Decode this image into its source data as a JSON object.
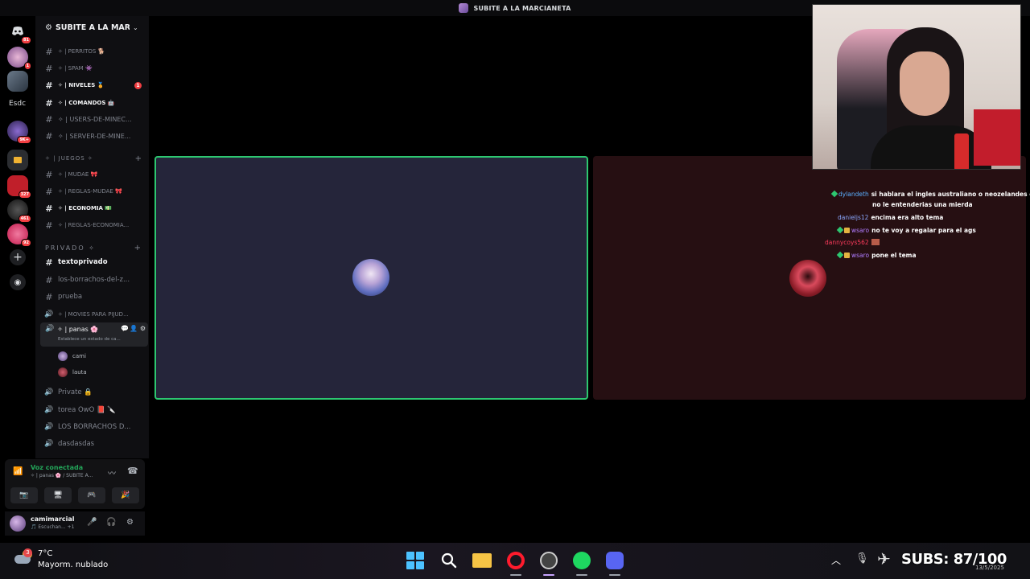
{
  "window": {
    "title": "SUBITE A LA MARCIANETA"
  },
  "rail": {
    "items": [
      {
        "icon": "discord-home-icon",
        "badge": "81"
      },
      {
        "icon": "server-avatar-icon",
        "badge": "1"
      },
      {
        "icon": "server-avatar-icon",
        "badge": ""
      },
      {
        "text": "Esdc"
      },
      {
        "icon": "server-avatar-icon",
        "badge": "9K+"
      },
      {
        "icon": "folder-icon",
        "badge": ""
      },
      {
        "icon": "server-avatar-icon",
        "badge": "327"
      },
      {
        "icon": "server-avatar-icon",
        "badge": "461"
      },
      {
        "icon": "server-avatar-icon",
        "badge": "92"
      }
    ]
  },
  "server": {
    "name": "SUBITE A LA MAR..."
  },
  "channels": [
    {
      "label": "✧ | PERRITOS 🐕",
      "type": "text"
    },
    {
      "label": "✧ | SPAM 👾",
      "type": "text"
    },
    {
      "label": "✧ | NIVELES 🏅",
      "type": "text",
      "unread": true,
      "mention": "1"
    },
    {
      "label": "✧ | COMANDOS 🤖",
      "type": "text",
      "unread": true
    },
    {
      "label": "✧ | USERS-DE-MINEC...",
      "type": "text"
    },
    {
      "label": "✧ | SERVER-DE-MINE...",
      "type": "text"
    },
    {
      "label": "✧ | MUDAE 🎀",
      "type": "text"
    },
    {
      "label": "✧ | REGLAS-MUDAE 🎀",
      "type": "text"
    },
    {
      "label": "✧ | ECONOMIA 💵",
      "type": "text",
      "unread": true
    },
    {
      "label": "✧ | REGLAS-ECONOMIA...",
      "type": "text"
    },
    {
      "label": "textoprivado",
      "type": "text",
      "unread": true
    },
    {
      "label": "los-borrachos-del-z...",
      "type": "text"
    },
    {
      "label": "prueba",
      "type": "text"
    },
    {
      "label": "✧ | MOVIES PARA PIJUD...",
      "type": "voice"
    },
    {
      "label": "✧ | panas 🌸",
      "type": "voice",
      "active": true,
      "status": "Establece un estado de ca..."
    },
    {
      "label": "Private 🔒",
      "type": "voice"
    },
    {
      "label": "torea OwO 📕 🔪",
      "type": "voice"
    },
    {
      "label": "LOS BORRACHOS D...",
      "type": "voice"
    },
    {
      "label": "dasdasdas",
      "type": "voice"
    }
  ],
  "categories": {
    "juegos": "✧ | JUEGOS ✧",
    "privado": "PRIVADO ✧"
  },
  "voice_users": [
    "cami",
    "lauta"
  ],
  "voice_panel": {
    "status": "Voz conectada",
    "channel": "✧ | panas 🌸 / SUBITE A..."
  },
  "user_panel": {
    "name": "camimarcial",
    "status": "🎵 Escuchan... +1"
  },
  "chat": [
    {
      "user": "dylandeth",
      "color": "#5bb0ff",
      "text": "si hablara el ingles australiano o neozelandes ese",
      "cont": "no le entenderias una mierda",
      "badge": "diamond"
    },
    {
      "user": "danieljs12",
      "color": "#8aa8ff",
      "text": "encima era alto tema",
      "badge": ""
    },
    {
      "user": "wsaro",
      "color": "#b07cff",
      "text": "no te voy a regalar       para el ags",
      "badge": "both"
    },
    {
      "user": "dannycoys562",
      "color": "#ff3b5c",
      "text": "",
      "badge": "emote"
    },
    {
      "user": "wsaro",
      "color": "#b07cff",
      "text": "pone el tema",
      "badge": "both"
    }
  ],
  "taskbar": {
    "weather_temp": "7°C",
    "weather_desc": "Mayorm. nublado",
    "weather_badge": "3",
    "subs": "SUBS: 87/100",
    "clock": "13/5/2025"
  },
  "colors": {
    "speaking": "#2dc770",
    "discord": "#5865f2",
    "spotify": "#1ed760",
    "opera": "#ff1b2d"
  }
}
